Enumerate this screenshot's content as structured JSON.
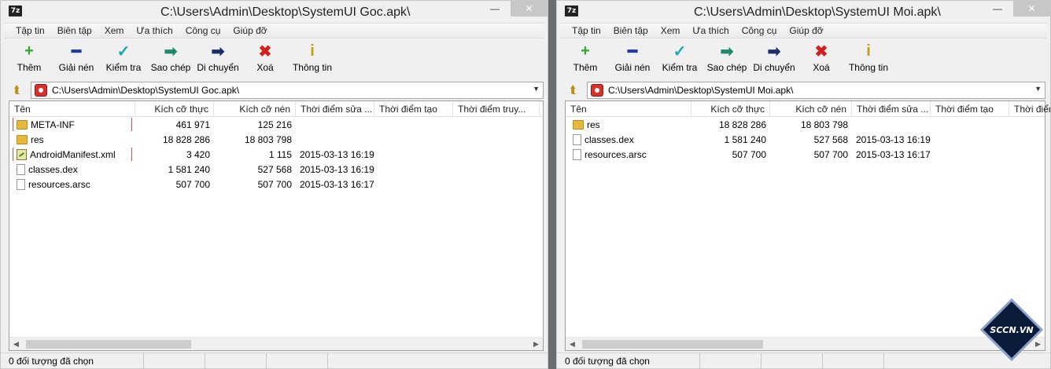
{
  "left": {
    "title": "C:\\Users\\Admin\\Desktop\\SystemUI Goc.apk\\",
    "path": "C:\\Users\\Admin\\Desktop\\SystemUI Goc.apk\\",
    "columns": [
      "Tên",
      "Kích cỡ thực",
      "Kích cỡ nén",
      "Thời điểm sửa ...",
      "Thời điểm tạo",
      "Thời điểm truy..."
    ],
    "rows": [
      {
        "name": "META-INF",
        "size": "461 971",
        "packed": "125 216",
        "modified": "",
        "icon": "folder-icon",
        "highlight": true
      },
      {
        "name": "res",
        "size": "18 828 286",
        "packed": "18 803 798",
        "modified": "",
        "icon": "folder-icon",
        "highlight": false
      },
      {
        "name": "AndroidManifest.xml",
        "size": "3 420",
        "packed": "1 115",
        "modified": "2015-03-13 16:19",
        "icon": "xml-file-icon",
        "highlight": true
      },
      {
        "name": "classes.dex",
        "size": "1 581 240",
        "packed": "527 568",
        "modified": "2015-03-13 16:19",
        "icon": "file-icon",
        "highlight": false
      },
      {
        "name": "resources.arsc",
        "size": "507 700",
        "packed": "507 700",
        "modified": "2015-03-13 16:17",
        "icon": "file-icon",
        "highlight": false
      }
    ],
    "status": "0 đối tượng đã chọn"
  },
  "right": {
    "title": "C:\\Users\\Admin\\Desktop\\SystemUI Moi.apk\\",
    "path": "C:\\Users\\Admin\\Desktop\\SystemUI Moi.apk\\",
    "columns": [
      "Tên",
      "Kích cỡ thực",
      "Kích cỡ nén",
      "Thời điểm sửa ...",
      "Thời điểm tạo",
      "Thời điểm truy..."
    ],
    "rows": [
      {
        "name": "res",
        "size": "18 828 286",
        "packed": "18 803 798",
        "modified": "",
        "icon": "folder-icon",
        "highlight": false
      },
      {
        "name": "classes.dex",
        "size": "1 581 240",
        "packed": "527 568",
        "modified": "2015-03-13 16:19",
        "icon": "file-icon",
        "highlight": false
      },
      {
        "name": "resources.arsc",
        "size": "507 700",
        "packed": "507 700",
        "modified": "2015-03-13 16:17",
        "icon": "file-icon",
        "highlight": false
      }
    ],
    "status": "0 đối tượng đã chọn"
  },
  "app_icon": "7z",
  "menus": [
    "Tập tin",
    "Biên tập",
    "Xem",
    "Ưa thích",
    "Công cụ",
    "Giúp đỡ"
  ],
  "toolbar": [
    {
      "label": "Thêm",
      "icon": "plus-icon",
      "glyph": "+",
      "color": "#2fa52f"
    },
    {
      "label": "Giải nén",
      "icon": "minus-icon",
      "glyph": "━",
      "color": "#1e3aa8"
    },
    {
      "label": "Kiểm tra",
      "icon": "check-icon",
      "glyph": "✓",
      "color": "#18a7b5"
    },
    {
      "label": "Sao chép",
      "icon": "copy-arrow-icon",
      "glyph": "➡",
      "color": "#1f8a6b"
    },
    {
      "label": "Di chuyển",
      "icon": "move-arrow-icon",
      "glyph": "➡",
      "color": "#1c2d6b"
    },
    {
      "label": "Xoá",
      "icon": "delete-x-icon",
      "glyph": "✖",
      "color": "#d22020"
    },
    {
      "label": "Thông tin",
      "icon": "info-icon",
      "glyph": "i",
      "color": "#c79b12"
    }
  ],
  "watermark": "SCCN.VN"
}
